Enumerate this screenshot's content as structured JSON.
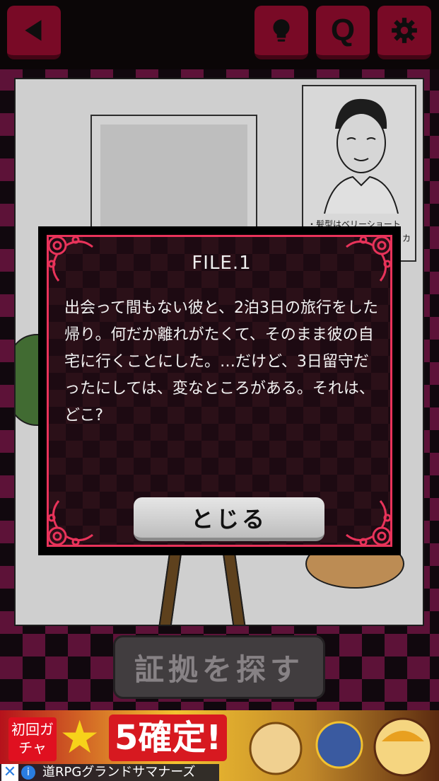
{
  "toolbar": {
    "back_icon": "back-arrow-icon",
    "hint_icon": "lightbulb-icon",
    "question_label": "Q",
    "settings_icon": "gear-icon",
    "button_color": "#8a0c2c"
  },
  "scene": {
    "portrait_line1": "・髪型はベリーショート",
    "portrait_line2": "カ"
  },
  "modal": {
    "title": "FILE.1",
    "body": "出会って間もない彼と、2泊3日の旅行をした帰り。何だか離れがたくて、そのまま彼の自宅に行くことにした。…だけど、3日留守だったにしては、変なところがある。それは、どこ?",
    "close_label": "とじる",
    "accent_color": "#e8335a"
  },
  "search_button": {
    "label": "証拠を探す"
  },
  "ad": {
    "badge_text": "初回ガチャ",
    "headline": "5確定!",
    "game_name": "道RPGグランドサマナーズ",
    "close_symbol": "✕",
    "info_symbol": "i"
  }
}
